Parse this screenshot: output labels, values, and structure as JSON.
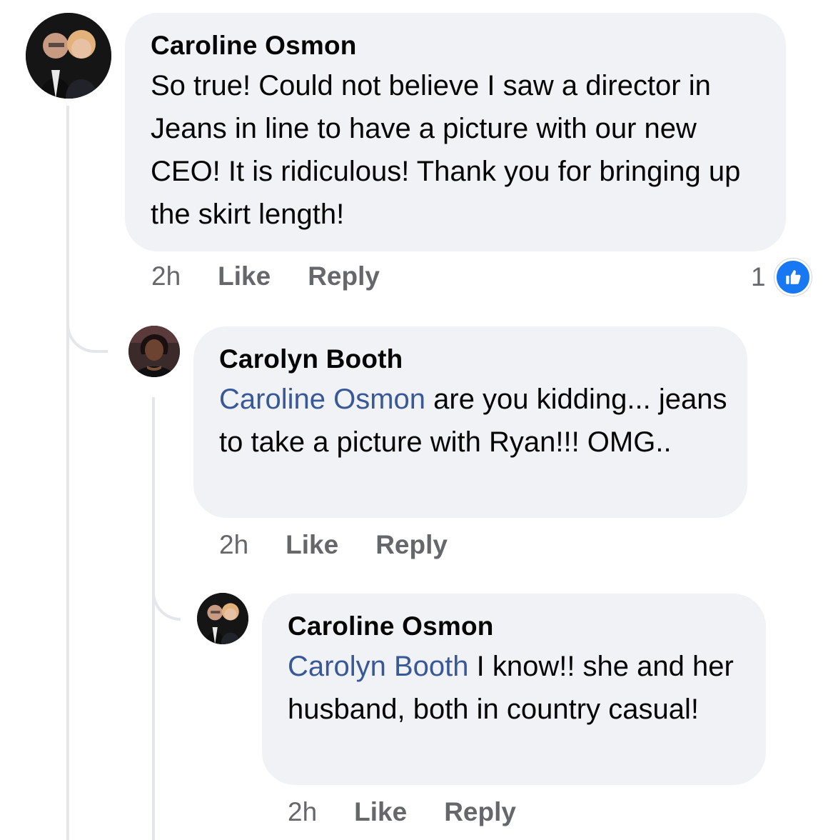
{
  "comments": [
    {
      "author": "Caroline Osmon",
      "mention": "",
      "text": "So true! Could not believe I saw a director in Jeans in line to have a picture with our new CEO! It is ridiculous! Thank you for bringing up the skirt length!",
      "time": "2h",
      "like_label": "Like",
      "reply_label": "Reply",
      "reaction_count": "1",
      "reaction_icon": "thumbs-up-icon",
      "avatar": "couple-photo"
    },
    {
      "author": "Carolyn Booth",
      "mention": "Caroline Osmon",
      "text": " are you kidding... jeans to take a picture with Ryan!!! OMG..",
      "time": "2h",
      "like_label": "Like",
      "reply_label": "Reply",
      "avatar": "woman-photo"
    },
    {
      "author": "Caroline Osmon",
      "mention": "Carolyn Booth",
      "text": " I know!! she and her husband, both in country casual!",
      "time": "2h",
      "like_label": "Like",
      "reply_label": "Reply",
      "avatar": "couple-photo"
    }
  ],
  "colors": {
    "bubble": "#f0f2f5",
    "mention": "#385898",
    "meta": "#65676b",
    "like_badge": "#1877f2"
  }
}
